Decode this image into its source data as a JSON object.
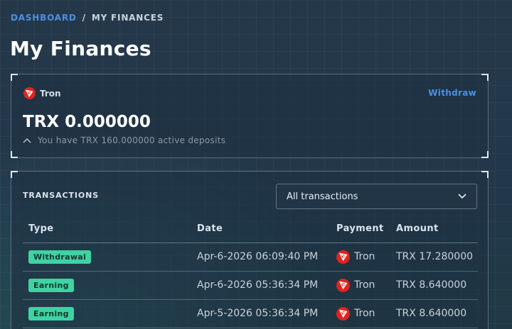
{
  "breadcrumb": {
    "parent": "DASHBOARD",
    "separator": "/",
    "current": "MY FINANCES"
  },
  "page_title": "My Finances",
  "balance_card": {
    "coin_name": "Tron",
    "coin_icon": "tron-icon",
    "withdraw_label": "Withdraw",
    "amount": "TRX 0.000000",
    "deposits_text": "You have TRX 160.000000 active deposits",
    "deposits_toggle_icon": "chevron-up-icon"
  },
  "transactions": {
    "heading": "TRANSACTIONS",
    "filter": {
      "selected": "All transactions",
      "icon": "chevron-down-icon"
    },
    "columns": {
      "type": "Type",
      "date": "Date",
      "payment": "Payment",
      "amount": "Amount"
    },
    "rows": [
      {
        "type": "Withdrawal",
        "date": "Apr-6-2026 06:09:40 PM",
        "payment": "Tron",
        "amount": "TRX 17.280000"
      },
      {
        "type": "Earning",
        "date": "Apr-6-2026 05:36:34 PM",
        "payment": "Tron",
        "amount": "TRX 8.640000"
      },
      {
        "type": "Earning",
        "date": "Apr-5-2026 05:36:34 PM",
        "payment": "Tron",
        "amount": "TRX 8.640000"
      }
    ]
  },
  "colors": {
    "accent": "#4a90e2",
    "badge": "#3fd3a3",
    "tron_red": "#e0231f"
  }
}
